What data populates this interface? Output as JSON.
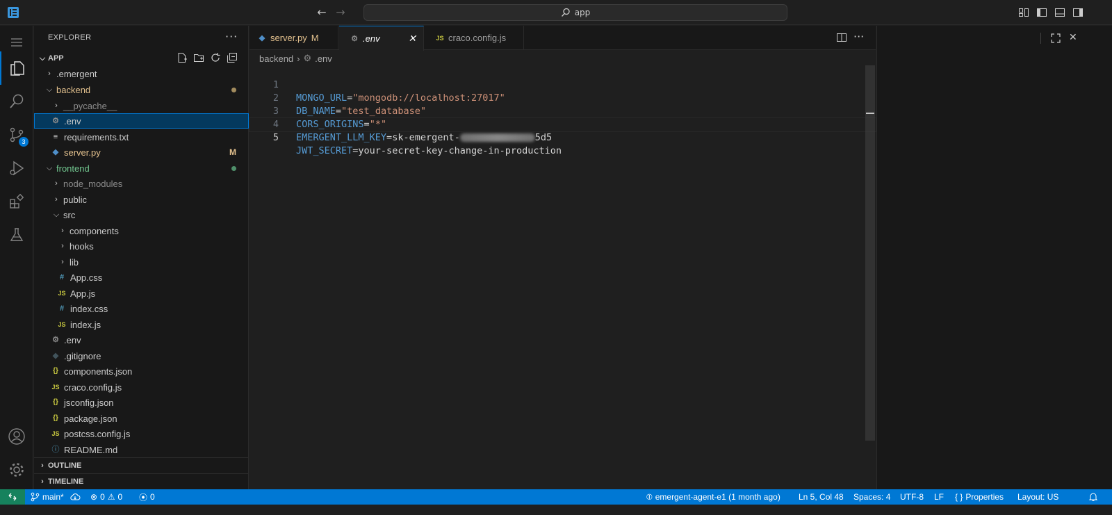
{
  "titlebar": {
    "search_text": "app"
  },
  "activity_bar": {
    "items": [
      "explorer",
      "search",
      "source-control",
      "run-and-debug",
      "extensions",
      "testing",
      "accounts",
      "manage"
    ],
    "source_control_badge": "3"
  },
  "sidebar": {
    "title": "EXPLORER",
    "root_label": "APP",
    "tree": [
      {
        "label": ".emergent",
        "kind": "folder",
        "expanded": false
      },
      {
        "label": "backend",
        "kind": "folder",
        "expanded": true,
        "decoration": "modified-dot"
      },
      {
        "label": "__pycache__",
        "kind": "folder",
        "expanded": false
      },
      {
        "label": ".env",
        "kind": "env",
        "selected": true
      },
      {
        "label": "requirements.txt",
        "kind": "txt"
      },
      {
        "label": "server.py",
        "kind": "python",
        "decoration_text": "M"
      },
      {
        "label": "frontend",
        "kind": "folder",
        "expanded": true,
        "decoration": "untracked-dot"
      },
      {
        "label": "node_modules",
        "kind": "folder",
        "expanded": false
      },
      {
        "label": "public",
        "kind": "folder",
        "expanded": false
      },
      {
        "label": "src",
        "kind": "folder",
        "expanded": true
      },
      {
        "label": "components",
        "kind": "folder",
        "expanded": false
      },
      {
        "label": "hooks",
        "kind": "folder",
        "expanded": false
      },
      {
        "label": "lib",
        "kind": "folder",
        "expanded": false
      },
      {
        "label": "App.css",
        "kind": "css"
      },
      {
        "label": "App.js",
        "kind": "js"
      },
      {
        "label": "index.css",
        "kind": "css"
      },
      {
        "label": "index.js",
        "kind": "js"
      },
      {
        "label": ".env",
        "kind": "env"
      },
      {
        "label": ".gitignore",
        "kind": "git"
      },
      {
        "label": "components.json",
        "kind": "json"
      },
      {
        "label": "craco.config.js",
        "kind": "js"
      },
      {
        "label": "jsconfig.json",
        "kind": "json"
      },
      {
        "label": "package.json",
        "kind": "json"
      },
      {
        "label": "postcss.config.js",
        "kind": "js"
      },
      {
        "label": "README.md",
        "kind": "info"
      }
    ],
    "outline_label": "OUTLINE",
    "timeline_label": "TIMELINE"
  },
  "editor": {
    "tabs": [
      {
        "label": "server.py",
        "suffix": "M",
        "kind": "python",
        "active": false
      },
      {
        "label": ".env",
        "suffix": "",
        "kind": "env",
        "active": true
      },
      {
        "label": "craco.config.js",
        "suffix": "",
        "kind": "js",
        "active": false
      }
    ],
    "breadcrumb": {
      "folder": "backend",
      "file": ".env"
    },
    "lines": [
      {
        "num": "1",
        "key": "MONGO_URL",
        "eq": "=",
        "value": "\"mongodb://localhost:27017\"",
        "value_kind": "string"
      },
      {
        "num": "2",
        "key": "DB_NAME",
        "eq": "=",
        "value": "\"test_database\"",
        "value_kind": "string"
      },
      {
        "num": "3",
        "key": "CORS_ORIGINS",
        "eq": "=",
        "value": "\"*\"",
        "value_kind": "string"
      },
      {
        "num": "4",
        "key": "EMERGENT_LLM_KEY",
        "eq": "=",
        "value_prefix": "sk-emergent-",
        "value_suffix": "5d5",
        "value_kind": "redacted"
      },
      {
        "num": "5",
        "key": "JWT_SECRET",
        "eq": "=",
        "value": "your-secret-key-change-in-production",
        "value_kind": "plain"
      }
    ],
    "current_line": 5
  },
  "statusbar": {
    "branch": "main*",
    "errors": "0",
    "warnings": "0",
    "ports": "0",
    "agent": "emergent-agent-e1 (1 month ago)",
    "cursor": "Ln 5, Col 48",
    "spaces": "Spaces: 4",
    "encoding": "UTF-8",
    "eol": "LF",
    "language": "Properties",
    "layout": "Layout: US"
  },
  "colors": {
    "accent": "#0078d4",
    "remote": "#16825d",
    "modified": "#e2c08d",
    "untracked": "#73c991",
    "key": "#569cd6",
    "string": "#ce9178"
  }
}
